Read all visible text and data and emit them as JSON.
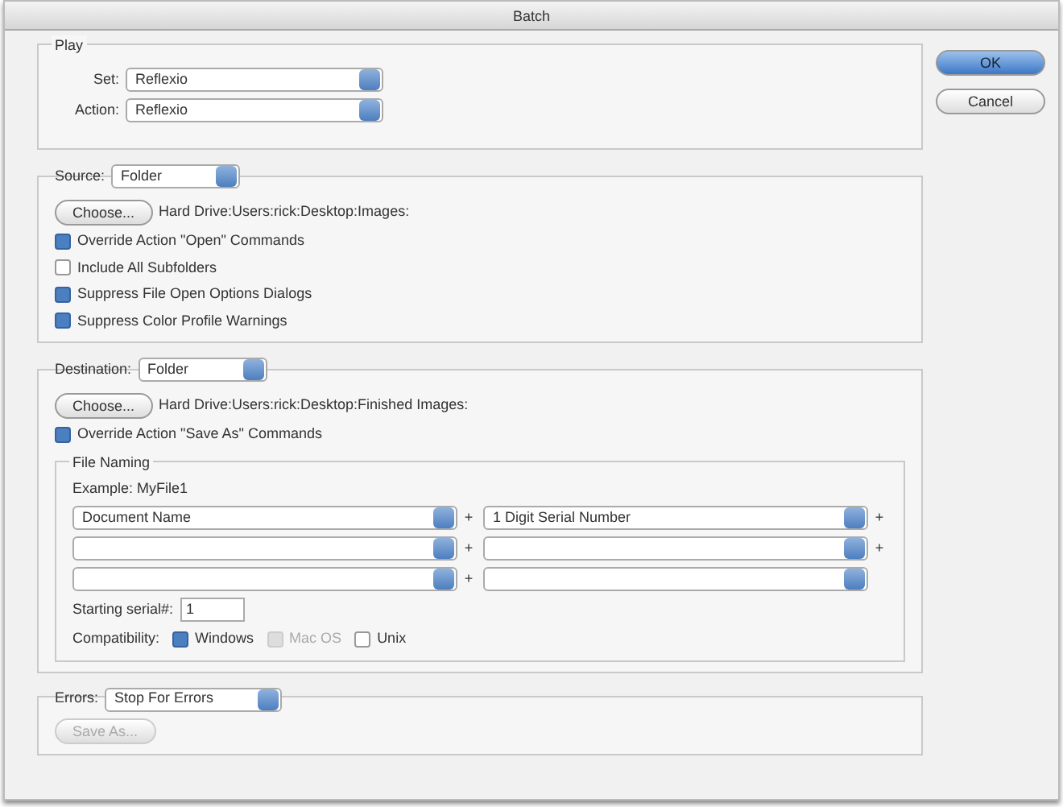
{
  "window": {
    "title": "Batch"
  },
  "play": {
    "label": "Play",
    "set": {
      "label": "Set:",
      "value": "Reflexio"
    },
    "action": {
      "label": "Action:",
      "value": "Reflexio"
    }
  },
  "source": {
    "label": "Source:",
    "value": "Folder",
    "choose": "Choose...",
    "path": "Hard Drive:Users:rick:Desktop:Images:",
    "options": [
      {
        "label": "Override Action \"Open\" Commands",
        "checked": true
      },
      {
        "label": "Include All Subfolders",
        "checked": false
      },
      {
        "label": "Suppress File Open Options Dialogs",
        "checked": true
      },
      {
        "label": "Suppress Color Profile Warnings",
        "checked": true
      }
    ]
  },
  "destination": {
    "label": "Destination:",
    "value": "Folder",
    "choose": "Choose...",
    "path": "Hard Drive:Users:rick:Desktop:Finished Images:",
    "override": {
      "label": "Override Action \"Save As\" Commands",
      "checked": true
    },
    "file_naming": {
      "label": "File Naming",
      "example": "Example: MyFile1",
      "rows": [
        [
          {
            "value": "Document Name",
            "suffix": "+"
          },
          {
            "value": "1 Digit Serial Number",
            "suffix": "+"
          }
        ],
        [
          {
            "suffix": "+"
          },
          {
            "suffix": "+"
          }
        ],
        [
          {
            "suffix": "+"
          },
          {}
        ]
      ],
      "serial": {
        "label": "Starting serial#:",
        "value": "1"
      },
      "compatibility": {
        "label": "Compatibility:",
        "options": [
          {
            "label": "Windows",
            "checked": true,
            "disabled": false
          },
          {
            "label": "Mac OS",
            "checked": true,
            "disabled": true
          },
          {
            "label": "Unix",
            "checked": false,
            "disabled": false
          }
        ]
      }
    }
  },
  "errors": {
    "label": "Errors:",
    "value": "Stop For Errors",
    "save_as": {
      "label": "Save As...",
      "disabled": true
    }
  },
  "buttons": [
    {
      "label": "OK",
      "default": true
    },
    {
      "label": "Cancel",
      "default": false
    }
  ]
}
